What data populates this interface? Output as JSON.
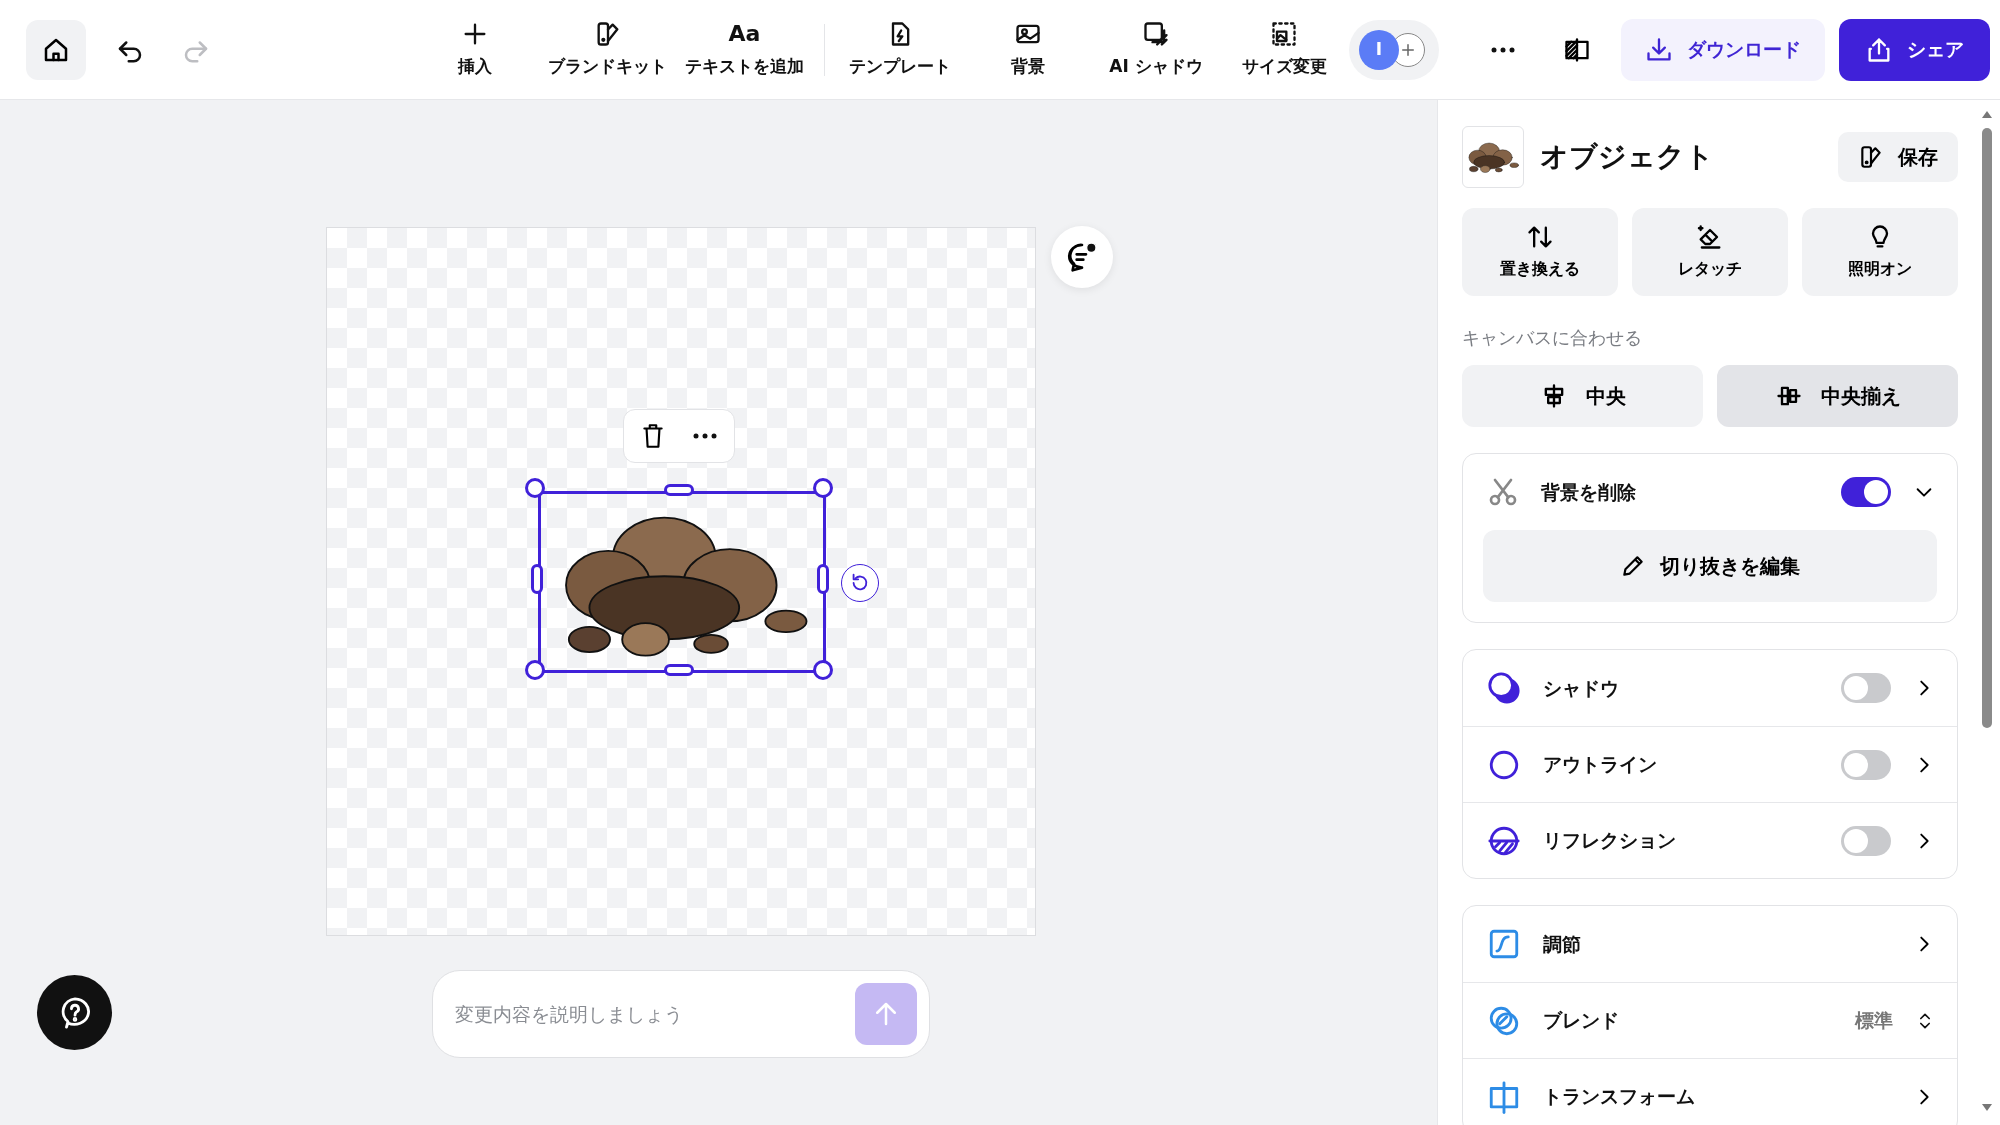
{
  "toolbar": {
    "history": [
      {
        "kind": "undo",
        "disabled": false
      },
      {
        "kind": "redo",
        "disabled": true
      }
    ],
    "tools": [
      {
        "kind": "insert",
        "label": "挿入"
      },
      {
        "kind": "brand",
        "label": "ブランドキット"
      },
      {
        "kind": "text",
        "label": "テキストを追加",
        "icon_text": "Aa"
      },
      {
        "kind": "template",
        "label": "テンプレート"
      },
      {
        "kind": "background",
        "label": "背景"
      },
      {
        "kind": "shadow",
        "label": "AI シャドウ"
      },
      {
        "kind": "resize",
        "label": "サイズ変更"
      }
    ],
    "avatar": "I",
    "download": "ダウンロード",
    "share": "シェア"
  },
  "canvas": {
    "prompt_placeholder": "変更内容を説明しましょう"
  },
  "panel": {
    "title": "オブジェクト",
    "save": "保存",
    "actions": [
      {
        "kind": "replace",
        "label": "置き換える"
      },
      {
        "kind": "retouch",
        "label": "レタッチ"
      },
      {
        "kind": "light",
        "label": "照明オン"
      }
    ],
    "fit_label": "キャンバスに合わせる",
    "fit_buttons": [
      {
        "kind": "center",
        "label": "中央",
        "selected": false
      },
      {
        "kind": "middle",
        "label": "中央揃え",
        "selected": true
      }
    ],
    "background_removal": {
      "label": "背景を削除",
      "on": true,
      "expanded": true,
      "edit_label": "切り抜きを編集"
    },
    "effects": [
      {
        "kind": "shadow",
        "label": "シャドウ",
        "on": false
      },
      {
        "kind": "outline",
        "label": "アウトライン",
        "on": false
      },
      {
        "kind": "reflection",
        "label": "リフレクション",
        "on": false
      }
    ],
    "adjustments": [
      {
        "kind": "adjust",
        "label": "調節"
      },
      {
        "kind": "blend",
        "label": "ブレンド",
        "value": "標準"
      },
      {
        "kind": "transform",
        "label": "トランスフォーム"
      }
    ]
  }
}
